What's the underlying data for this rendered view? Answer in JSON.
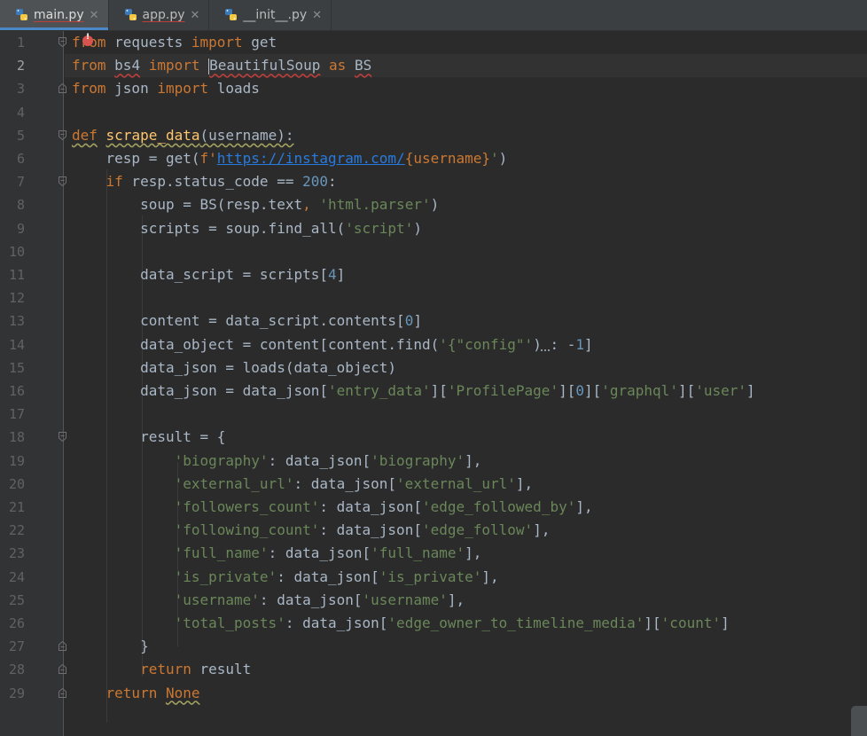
{
  "tabs": [
    {
      "label": "main.py",
      "active": true
    },
    {
      "label": "app.py",
      "active": false
    },
    {
      "label": "__init__.py",
      "active": false
    }
  ],
  "current_line": 2,
  "line_numbers": [
    "1",
    "2",
    "3",
    "4",
    "5",
    "6",
    "7",
    "8",
    "9",
    "10",
    "11",
    "12",
    "13",
    "14",
    "15",
    "16",
    "17",
    "18",
    "19",
    "20",
    "21",
    "22",
    "23",
    "24",
    "25",
    "26",
    "27",
    "28",
    "29"
  ],
  "code": {
    "l1": [
      "from",
      " requests ",
      "import",
      " get"
    ],
    "l2": [
      "from",
      " ",
      "bs4",
      " ",
      "import",
      " ",
      "BeautifulSoup",
      " ",
      "as",
      " ",
      "BS"
    ],
    "l3": [
      "from",
      " json ",
      "import",
      " loads"
    ],
    "l5": [
      "def",
      " ",
      "scrape_data",
      "(username):"
    ],
    "l6": [
      "    resp = get(",
      "f'",
      "https://instagram.com/",
      "{username}",
      "'",
      ")"
    ],
    "l7": [
      "    ",
      "if",
      " resp.status_code == ",
      "200",
      ":"
    ],
    "l8": [
      "        soup = BS(resp.text",
      ", ",
      "'html.parser'",
      ")"
    ],
    "l9": [
      "        scripts = soup.find_all(",
      "'script'",
      ")"
    ],
    "l11": [
      "        data_script = scripts[",
      "4",
      "]"
    ],
    "l13": [
      "        content = data_script.contents[",
      "0",
      "]"
    ],
    "l14": [
      "        data_object = content[content.find(",
      "'{\"config\"'",
      ")",
      " ",
      ": -",
      "1",
      "]"
    ],
    "l15": [
      "        data_json = loads(data_object)"
    ],
    "l16": [
      "        data_json = data_json[",
      "'entry_data'",
      "][",
      "'ProfilePage'",
      "][",
      "0",
      "][",
      "'graphql'",
      "][",
      "'user'",
      "]"
    ],
    "l18": [
      "        result = {"
    ],
    "l19": [
      "            ",
      "'biography'",
      ": data_json[",
      "'biography'",
      "],"
    ],
    "l20": [
      "            ",
      "'external_url'",
      ": data_json[",
      "'external_url'",
      "],"
    ],
    "l21": [
      "            ",
      "'followers_count'",
      ": data_json[",
      "'edge_followed_by'",
      "],"
    ],
    "l22": [
      "            ",
      "'following_count'",
      ": data_json[",
      "'edge_follow'",
      "],"
    ],
    "l23": [
      "            ",
      "'full_name'",
      ": data_json[",
      "'full_name'",
      "],"
    ],
    "l24": [
      "            ",
      "'is_private'",
      ": data_json[",
      "'is_private'",
      "],"
    ],
    "l25": [
      "            ",
      "'username'",
      ": data_json[",
      "'username'",
      "],"
    ],
    "l26": [
      "            ",
      "'total_posts'",
      ": data_json[",
      "'edge_owner_to_timeline_media'",
      "][",
      "'count'",
      "]"
    ],
    "l27": [
      "        }"
    ],
    "l28": [
      "        ",
      "return",
      " result"
    ],
    "l29": [
      "    ",
      "return",
      " ",
      "None"
    ]
  },
  "colors": {
    "keyword": "#cc7832",
    "function": "#ffc66d",
    "string": "#6a8759",
    "number": "#6897bb",
    "text": "#a9b7c6",
    "background": "#2b2b2b",
    "gutter": "#313335",
    "active_tab_underline": "#4a88c7"
  },
  "icons": {
    "tab_icon": "python-file-icon",
    "tab_close": "close-icon",
    "gutter_marker": "fold-icon",
    "error": "error-bulb-icon"
  },
  "close_glyph": "✕"
}
